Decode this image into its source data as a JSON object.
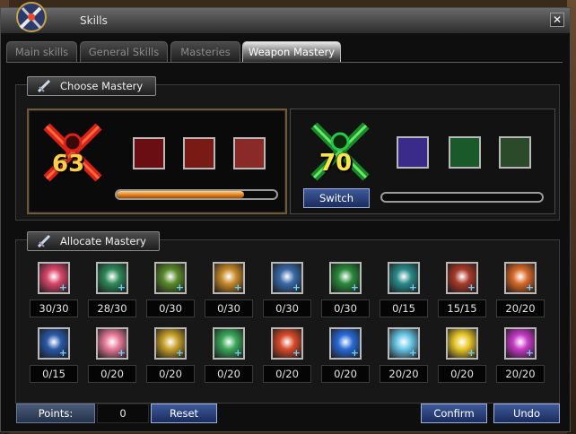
{
  "window": {
    "title": "Skills",
    "close": "✕"
  },
  "tabs": [
    "Main skills",
    "General Skills",
    "Masteries",
    "Weapon Mastery"
  ],
  "active_tab": 3,
  "choose_panel": {
    "title": "Choose Mastery"
  },
  "masteries": [
    {
      "level": "63",
      "selected": true,
      "progress": 0.8,
      "skill_icons": [
        "fang-skill-icon",
        "cross-blades-skill-icon",
        "claw-slash-skill-icon"
      ]
    },
    {
      "level": "70",
      "selected": false,
      "progress": 0.0,
      "skill_icons": [
        "shadow-strike-skill-icon",
        "green-blade-skill-icon",
        "dagger-skill-icon"
      ]
    }
  ],
  "switch_label": "Switch",
  "allocate_panel": {
    "title": "Allocate Mastery"
  },
  "skills_row1": [
    {
      "icon": "pink-strike-icon",
      "count": "30/30",
      "color": "#d8466a"
    },
    {
      "icon": "green-figure-icon",
      "count": "28/30",
      "color": "#2e8a5a"
    },
    {
      "icon": "green-fist-icon",
      "count": "0/30",
      "color": "#5a8a2a"
    },
    {
      "icon": "golden-fist-icon",
      "count": "0/30",
      "color": "#c88a2a"
    },
    {
      "icon": "shadow-figure-icon",
      "count": "0/30",
      "color": "#3a6aa8"
    },
    {
      "icon": "green-dash-icon",
      "count": "0/30",
      "color": "#2a8a3a"
    },
    {
      "icon": "cyan-ring-icon",
      "count": "0/15",
      "color": "#2a8a8a"
    },
    {
      "icon": "red-boot-icon",
      "count": "15/15",
      "color": "#a83a2a"
    },
    {
      "icon": "orange-burst-icon",
      "count": "20/20",
      "color": "#d86a2a"
    }
  ],
  "skills_row2": [
    {
      "icon": "blue-vortex-icon",
      "count": "0/15",
      "color": "#2a5aa8"
    },
    {
      "icon": "pink-heart-icon",
      "count": "0/20",
      "color": "#e87a9a"
    },
    {
      "icon": "gold-gauntlet-icon",
      "count": "0/20",
      "color": "#c8a02a"
    },
    {
      "icon": "green-tornado-icon",
      "count": "0/20",
      "color": "#3aa85a"
    },
    {
      "icon": "red-flame-icon",
      "count": "0/20",
      "color": "#d84a2a"
    },
    {
      "icon": "blue-lightning-icon",
      "count": "0/20",
      "color": "#2a6ad8"
    },
    {
      "icon": "ice-snowflake-icon",
      "count": "20/20",
      "color": "#6ac8e8"
    },
    {
      "icon": "yellow-star-icon",
      "count": "0/20",
      "color": "#e8c82a"
    },
    {
      "icon": "magenta-swirl-icon",
      "count": "20/20",
      "color": "#c83ac8"
    }
  ],
  "footer": {
    "points_label": "Points:",
    "points_value": "0",
    "reset": "Reset",
    "confirm": "Confirm",
    "undo": "Undo"
  }
}
